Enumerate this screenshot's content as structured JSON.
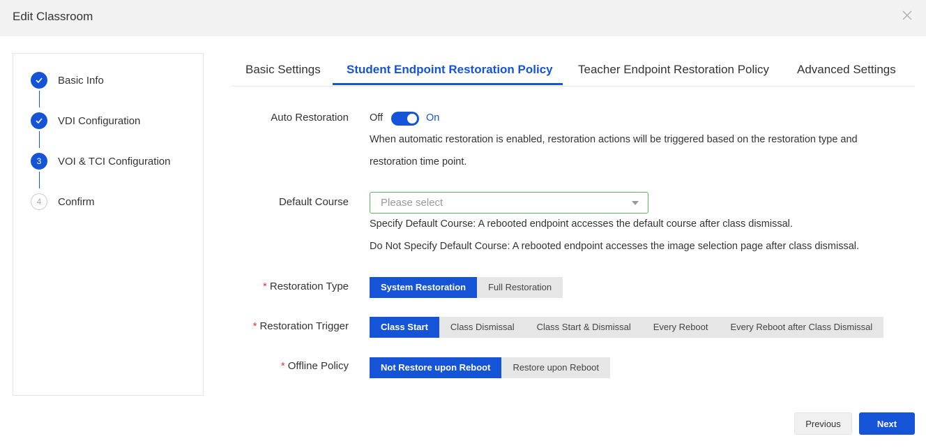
{
  "dialog": {
    "title": "Edit Classroom",
    "close_icon": "close-icon"
  },
  "steps": [
    {
      "number": "1",
      "label": "Basic Info",
      "state": "done"
    },
    {
      "number": "2",
      "label": "VDI Configuration",
      "state": "done"
    },
    {
      "number": "3",
      "label": "VOI & TCI Configuration",
      "state": "active"
    },
    {
      "number": "4",
      "label": "Confirm",
      "state": "todo"
    }
  ],
  "tabs": [
    {
      "label": "Basic Settings",
      "active": false
    },
    {
      "label": "Student Endpoint Restoration Policy",
      "active": true
    },
    {
      "label": "Teacher Endpoint Restoration Policy",
      "active": false
    },
    {
      "label": "Advanced Settings",
      "active": false
    }
  ],
  "auto_restoration": {
    "label": "Auto Restoration",
    "off_label": "Off",
    "on_label": "On",
    "enabled": true,
    "help_line1": "When automatic restoration is enabled, restoration actions will be triggered based on the restoration type and",
    "help_line2": "restoration time point."
  },
  "default_course": {
    "label": "Default Course",
    "placeholder": "Please select",
    "help_line1": "Specify Default Course: A rebooted endpoint accesses the default course after class dismissal.",
    "help_line2": "Do Not Specify Default Course: A rebooted endpoint accesses the image selection page after class dismissal."
  },
  "restoration_type": {
    "required_mark": "*",
    "label": "Restoration Type",
    "options": [
      "System Restoration",
      "Full Restoration"
    ],
    "selected": "System Restoration"
  },
  "restoration_trigger": {
    "required_mark": "*",
    "label": "Restoration Trigger",
    "options": [
      "Class Start",
      "Class Dismissal",
      "Class Start & Dismissal",
      "Every Reboot",
      "Every Reboot after Class Dismissal"
    ],
    "selected": "Class Start"
  },
  "offline_policy": {
    "required_mark": "*",
    "label": "Offline Policy",
    "options": [
      "Not Restore upon Reboot",
      "Restore upon Reboot"
    ],
    "selected": "Not Restore upon Reboot"
  },
  "footer": {
    "previous_label": "Previous",
    "next_label": "Next"
  },
  "colors": {
    "accent": "#1554d6",
    "required": "#e53935",
    "focus_border": "#5cb85c"
  }
}
